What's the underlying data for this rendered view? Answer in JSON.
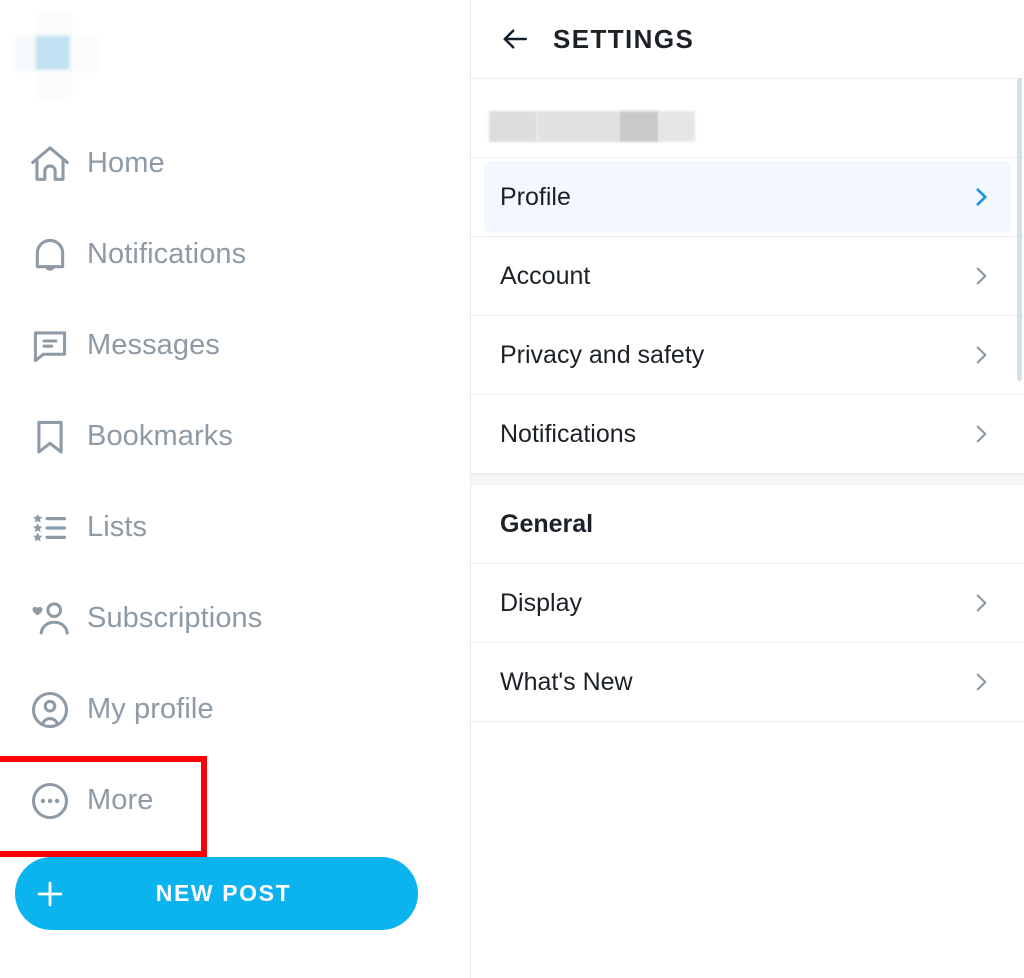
{
  "sidebar": {
    "logo": {
      "icon": "app-logo-redacted"
    },
    "items": [
      {
        "label": "Home",
        "icon": "home-icon"
      },
      {
        "label": "Notifications",
        "icon": "bell-icon"
      },
      {
        "label": "Messages",
        "icon": "message-icon"
      },
      {
        "label": "Bookmarks",
        "icon": "bookmark-icon"
      },
      {
        "label": "Lists",
        "icon": "lists-icon"
      },
      {
        "label": "Subscriptions",
        "icon": "subscriptions-icon"
      },
      {
        "label": "My profile",
        "icon": "profile-circle-icon"
      },
      {
        "label": "More",
        "icon": "more-ellipsis-icon",
        "highlighted": true
      }
    ],
    "new_post_button": {
      "label": "NEW POST",
      "icon": "plus-icon",
      "color": "#0bb3ef",
      "text_color": "#ffffff"
    },
    "text_color": "#8e9aa6",
    "highlight_color": "#fb0007"
  },
  "panel": {
    "header": {
      "title": "SETTINGS",
      "back_icon": "arrow-left-icon"
    },
    "account_row": {
      "value_redacted": true
    },
    "rows": [
      {
        "label": "Profile",
        "chevron": "chevron-right-icon",
        "selected": true
      },
      {
        "label": "Account",
        "chevron": "chevron-right-icon",
        "selected": false
      },
      {
        "label": "Privacy and safety",
        "chevron": "chevron-right-icon",
        "selected": false
      },
      {
        "label": "Notifications",
        "chevron": "chevron-right-icon",
        "selected": false
      }
    ],
    "section": {
      "title": "General",
      "rows": [
        {
          "label": "Display",
          "chevron": "chevron-right-icon"
        },
        {
          "label": "What's New",
          "chevron": "chevron-right-icon"
        }
      ]
    },
    "selected_bg": "#f2f8fd",
    "selected_chevron_color": "#1193e8",
    "chevron_color": "#8e9aa6",
    "text_color": "#1b2127"
  }
}
